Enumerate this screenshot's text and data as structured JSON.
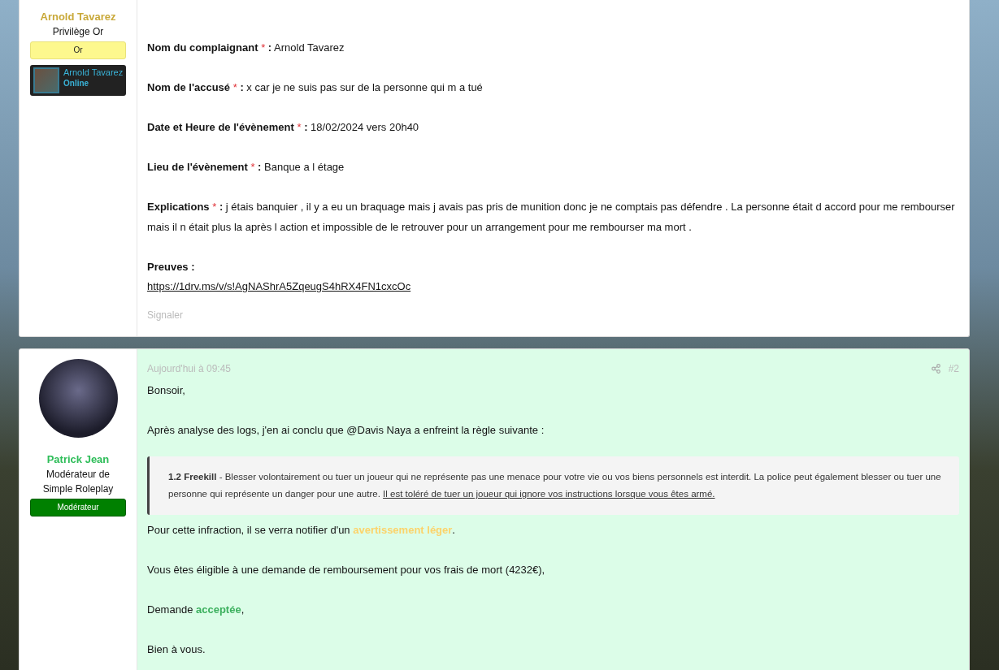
{
  "posts": [
    {
      "author": {
        "name": "Arnold Tavarez",
        "color": "#c9a93a",
        "title": "Privilège Or",
        "banner": {
          "label": "Or",
          "kind": "gold"
        },
        "userbox": {
          "name": "Arnold Tavarez",
          "status": "Online"
        }
      },
      "highlighted": false,
      "fields": [
        {
          "label": "Nom du complaignant",
          "mark": "*",
          "colon": ":",
          "value": "Arnold Tavarez"
        },
        {
          "label": "Nom de l'accusé",
          "mark": "*",
          "colon": ":",
          "value": "x car je ne suis pas sur de la personne qui m a tué"
        },
        {
          "label": "Date et Heure de l'évènement",
          "mark": "*",
          "colon": ":",
          "value": "18/02/2024 vers 20h40"
        },
        {
          "label": "Lieu de l'évènement",
          "mark": "*",
          "colon": ":",
          "value": "Banque a l étage"
        },
        {
          "label": "Explications",
          "mark": "*",
          "colon": ":",
          "value": "j étais banquier , il y a eu un braquage mais j avais pas pris de munition donc je ne comptais pas défendre . La personne était d accord pour me rembourser mais il n était plus la après l action et impossible de le retrouver pour un arrangement pour me rembourser ma mort ."
        }
      ],
      "proof": {
        "label": "Preuves :",
        "link": "https://1drv.ms/v/s!AgNAShrA5ZqeugS4hRX4FN1cxcOc"
      },
      "report": "Signaler"
    },
    {
      "author": {
        "name": "Patrick Jean",
        "color": "#2ebd59",
        "title": "Modérateur de Simple Roleplay",
        "banner": {
          "label": "Modérateur",
          "kind": "moderator"
        }
      },
      "highlighted": true,
      "date": "Aujourd'hui à 09:45",
      "number": "#2",
      "blocks": [
        {
          "kind": "paragraph",
          "segments": [
            {
              "text": "Bonsoir,",
              "kind": "plain"
            }
          ]
        },
        {
          "kind": "paragraph",
          "segments": [
            {
              "text": "Après analyse des logs, j'en ai conclu que @Davis Naya a enfreint la règle suivante :",
              "kind": "plain"
            }
          ]
        },
        {
          "kind": "quote",
          "segments": [
            {
              "text": "1.2 Freekill",
              "kind": "bold"
            },
            {
              "text": " - Blesser volontairement ou tuer un joueur qui ne représente pas une menace pour votre vie ou vos biens personnels est interdit. La police peut également blesser ou tuer une personne qui représente un danger pour une autre. ",
              "kind": "plain"
            },
            {
              "text": "Il est toléré de tuer un joueur qui ignore vos instructions lorsque vous êtes armé.",
              "kind": "underline"
            }
          ]
        },
        {
          "kind": "paragraph",
          "segments": [
            {
              "text": "Pour cette infraction, il se verra notifier d'un ",
              "kind": "plain"
            },
            {
              "text": "avertissement léger",
              "kind": "warning"
            },
            {
              "text": ".",
              "kind": "plain"
            }
          ]
        },
        {
          "kind": "paragraph",
          "segments": [
            {
              "text": "Vous êtes éligible à une demande de remboursement pour vos frais de mort (4232€),",
              "kind": "plain"
            }
          ]
        },
        {
          "kind": "paragraph",
          "segments": [
            {
              "text": "Demande ",
              "kind": "plain"
            },
            {
              "text": "acceptée",
              "kind": "success"
            },
            {
              "text": ",",
              "kind": "plain"
            }
          ]
        },
        {
          "kind": "paragraph",
          "segments": [
            {
              "text": "Bien à vous.",
              "kind": "plain"
            }
          ]
        }
      ]
    }
  ]
}
